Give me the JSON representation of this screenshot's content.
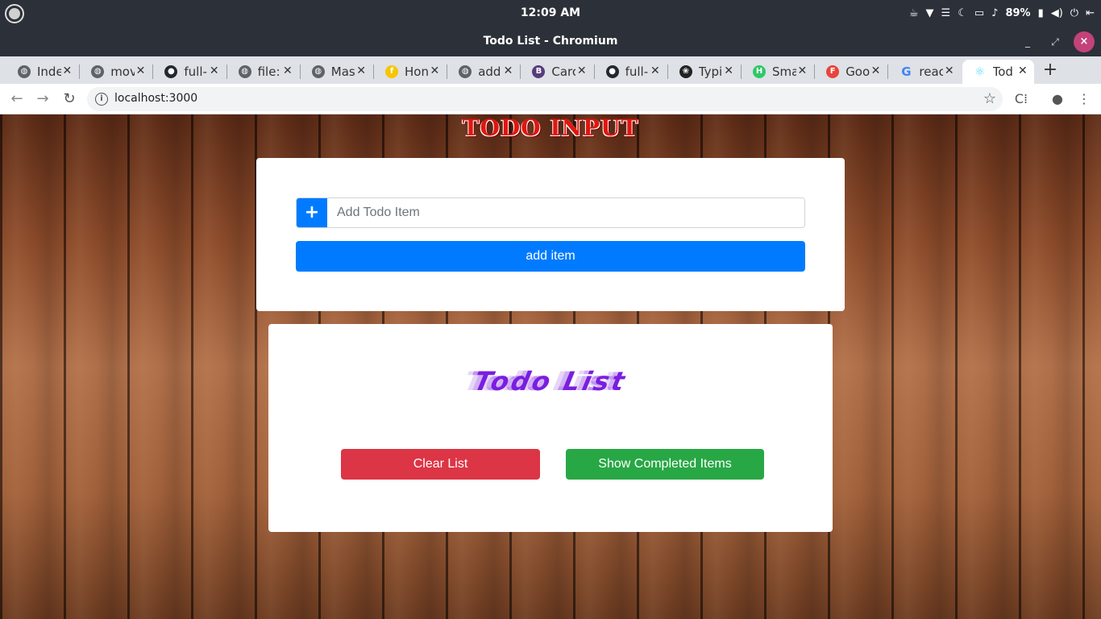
{
  "os": {
    "clock": "12:09 AM",
    "battery_percent": "89%",
    "tray_icons": [
      "coffee-icon",
      "wifi-icon",
      "menu-icon",
      "moon-icon",
      "folder-icon",
      "bell-icon",
      "battery-icon",
      "volume-icon",
      "power-icon",
      "logout-icon"
    ]
  },
  "window": {
    "title": "Todo List - Chromium"
  },
  "tabs": [
    {
      "label": "Inde",
      "icon": "globe-icon",
      "color": "#5f6368"
    },
    {
      "label": "mov",
      "icon": "globe-icon",
      "color": "#5f6368"
    },
    {
      "label": "full-",
      "icon": "github-icon",
      "color": "#24292e"
    },
    {
      "label": "file:",
      "icon": "globe-icon",
      "color": "#5f6368"
    },
    {
      "label": "Mas",
      "icon": "globe-icon",
      "color": "#5f6368"
    },
    {
      "label": "Hon",
      "icon": "flipkart-icon",
      "color": "#f7c600"
    },
    {
      "label": "add",
      "icon": "globe-icon",
      "color": "#5f6368"
    },
    {
      "label": "Carc",
      "icon": "bootstrap-icon",
      "color": "#563d7c"
    },
    {
      "label": "full-",
      "icon": "github-icon",
      "color": "#24292e"
    },
    {
      "label": "Typi",
      "icon": "paw-icon",
      "color": "#222222"
    },
    {
      "label": "Sma",
      "icon": "h-icon",
      "color": "#2ec866"
    },
    {
      "label": "Goo",
      "icon": "f-icon",
      "color": "#e8453c"
    },
    {
      "label": "reac",
      "icon": "google-icon",
      "color": "#4285f4"
    },
    {
      "label": "Tod",
      "icon": "react-icon",
      "color": "#61dafb"
    }
  ],
  "toolbar": {
    "url": "localhost:3000"
  },
  "page": {
    "heading": "TODO INPUT",
    "input_placeholder": "Add Todo Item",
    "input_value": "",
    "add_button": "add item",
    "list_heading": "Todo List",
    "clear_button": "Clear List",
    "completed_button": "Show Completed Items"
  },
  "colors": {
    "primary": "#007bff",
    "danger": "#dc3545",
    "success": "#28a745",
    "heading_red": "#e0160e",
    "list_purple": "#7a1ee0"
  }
}
